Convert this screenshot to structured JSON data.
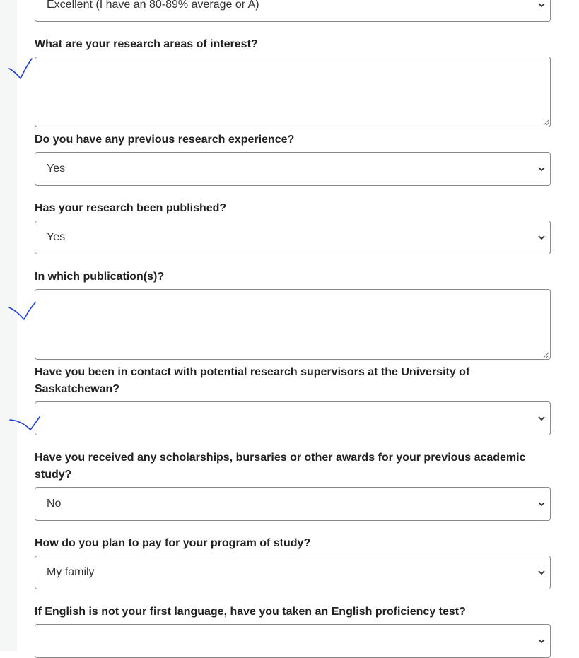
{
  "form": {
    "academic_standing": {
      "value": "Excellent (I have an 80-89% average or A)"
    },
    "research_areas": {
      "label": "What are your research areas of interest?",
      "value": ""
    },
    "research_experience": {
      "label": "Do you have any previous research experience?",
      "value": "Yes"
    },
    "research_published": {
      "label": "Has your research been published?",
      "value": "Yes"
    },
    "publications": {
      "label": "In which publication(s)?",
      "value": ""
    },
    "supervisor_contact": {
      "label": "Have you been in contact with potential research supervisors at the University of Saskatchewan?",
      "value": ""
    },
    "scholarships": {
      "label": "Have you received any scholarships, bursaries or other awards for your previous academic study?",
      "value": "No"
    },
    "payment_plan": {
      "label": "How do you plan to pay for your program of study?",
      "value": "My family"
    },
    "english_test": {
      "label": "If English is not your first language, have you taken an English proficiency test?",
      "value": ""
    }
  },
  "colors": {
    "annotation_ink": "#1f3fd8",
    "border": "#8a8a8a"
  },
  "icons": {
    "select_arrow": "chevron-down-icon",
    "resize_grip": "resize-grip-icon",
    "annotation": "handwritten-checkmark-icon"
  }
}
